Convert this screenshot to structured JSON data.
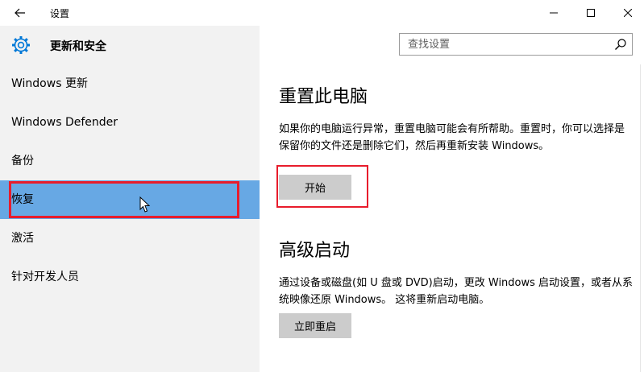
{
  "window": {
    "title": "设置",
    "controls": {
      "minimize": "minimize-icon",
      "maximize": "maximize-icon",
      "close": "close-icon"
    }
  },
  "header": {
    "category_icon": "gear-icon",
    "category_title": "更新和安全",
    "search": {
      "placeholder": "查找设置",
      "value": ""
    }
  },
  "sidebar": {
    "items": [
      {
        "label": "Windows 更新"
      },
      {
        "label": "Windows Defender"
      },
      {
        "label": "备份"
      },
      {
        "label": "恢复",
        "selected": true
      },
      {
        "label": "激活"
      },
      {
        "label": "针对开发人员"
      }
    ]
  },
  "main": {
    "reset": {
      "title": "重置此电脑",
      "description": "如果你的电脑运行异常，重置电脑可能会有所帮助。重置时，你可以选择是保留你的文件还是删除它们，然后再重新安装 Windows。",
      "button": "开始"
    },
    "advanced": {
      "title": "高级启动",
      "description": "通过设备或磁盘(如 U 盘或 DVD)启动，更改 Windows 启动设置，或者从系统映像还原 Windows。 这将重新启动电脑。",
      "button": "立即重启"
    }
  },
  "colors": {
    "selected_item": "#67a8e4",
    "highlight_frame": "#e81c2c",
    "accent": "#0078d7",
    "button": "#cccccc"
  }
}
